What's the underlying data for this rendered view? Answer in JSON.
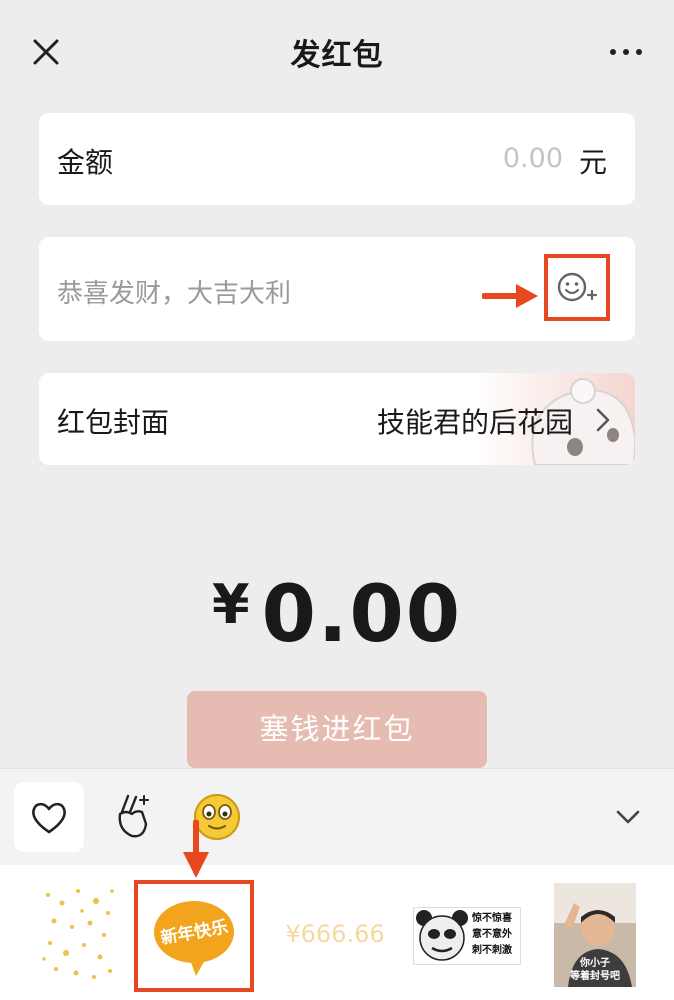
{
  "header": {
    "title": "发红包",
    "close_icon": "close-icon",
    "more_icon": "more-dots-icon"
  },
  "amount_card": {
    "label": "金额",
    "value": "0.00",
    "unit": "元"
  },
  "greeting_card": {
    "placeholder": "恭喜发财，大吉大利",
    "emoji_icon": "add-emoji-icon"
  },
  "cover_card": {
    "label": "红包封面",
    "value": "技能君的后花园",
    "chevron_icon": "chevron-right-icon"
  },
  "total": {
    "currency": "¥",
    "value": "0.00"
  },
  "submit": {
    "label": "塞钱进红包"
  },
  "emoji_panel": {
    "tabs": [
      "heart-icon",
      "fingers-icon",
      "smiley-icon"
    ],
    "collapse_icon": "chevron-down-icon",
    "stickers": {
      "new_year": "新年快乐",
      "money": "¥666.66",
      "panda_lines": [
        "惊不惊喜",
        "意不意外",
        "刺不刺激"
      ],
      "photo_lines": [
        "你小子",
        "等着封号吧"
      ]
    }
  },
  "colors": {
    "accent": "#e8481f",
    "button": "#e6bbb1",
    "bubble": "#f2a51c"
  }
}
